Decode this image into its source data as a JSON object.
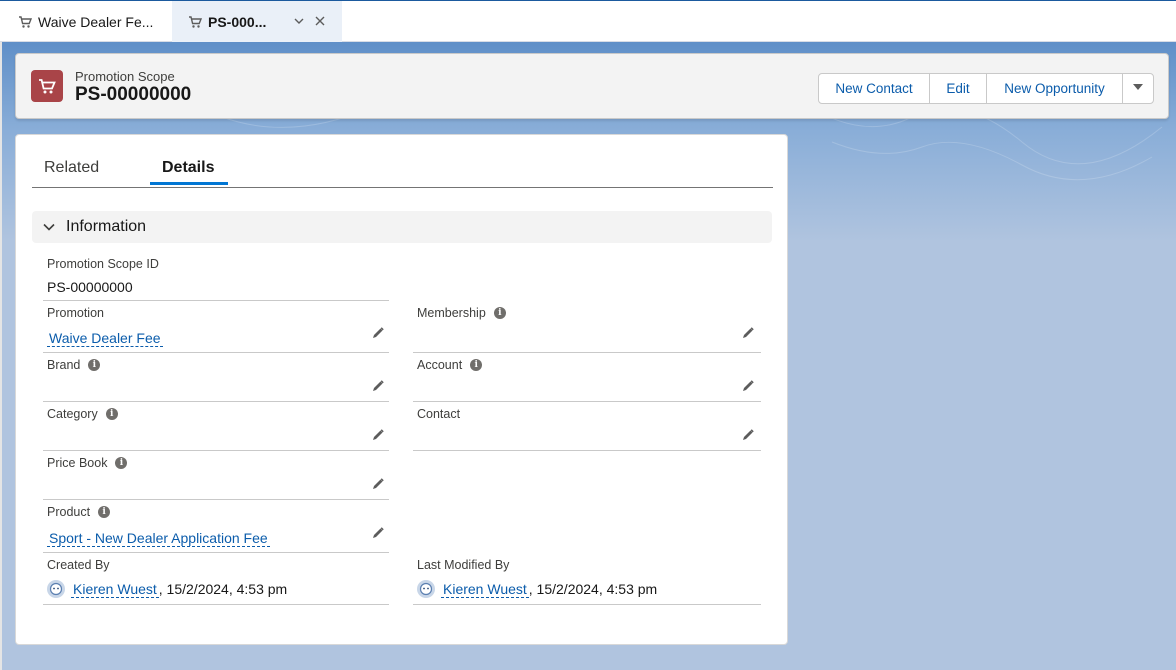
{
  "tabs": [
    {
      "label": "Waive Dealer Fe...",
      "icon": "cart-icon",
      "active": false
    },
    {
      "label": "PS-000...",
      "icon": "cart-icon",
      "active": true
    }
  ],
  "header": {
    "object_type": "Promotion Scope",
    "record_name": "PS-00000000",
    "icon": "cart-icon",
    "icon_color": "#a94448",
    "actions": [
      "New Contact",
      "Edit",
      "New Opportunity"
    ]
  },
  "record_tabs": {
    "related": "Related",
    "details": "Details"
  },
  "section": {
    "title": "Information"
  },
  "fields": {
    "promotion_scope_id": {
      "label": "Promotion Scope ID",
      "value": "PS-00000000"
    },
    "promotion": {
      "label": "Promotion",
      "value": "Waive Dealer Fee"
    },
    "membership": {
      "label": "Membership",
      "value": ""
    },
    "brand": {
      "label": "Brand",
      "value": ""
    },
    "account": {
      "label": "Account",
      "value": ""
    },
    "category": {
      "label": "Category",
      "value": ""
    },
    "contact": {
      "label": "Contact",
      "value": ""
    },
    "price_book": {
      "label": "Price Book",
      "value": ""
    },
    "product": {
      "label": "Product",
      "value": "Sport - New Dealer Application Fee"
    },
    "created_by": {
      "label": "Created By",
      "user": "Kieren Wuest",
      "date": ", 15/2/2024, 4:53 pm"
    },
    "last_modified_by": {
      "label": "Last Modified By",
      "user": "Kieren Wuest",
      "date": ", 15/2/2024, 4:53 pm"
    }
  },
  "colors": {
    "link": "#0b5cab",
    "brand_blue": "#0176d3"
  }
}
